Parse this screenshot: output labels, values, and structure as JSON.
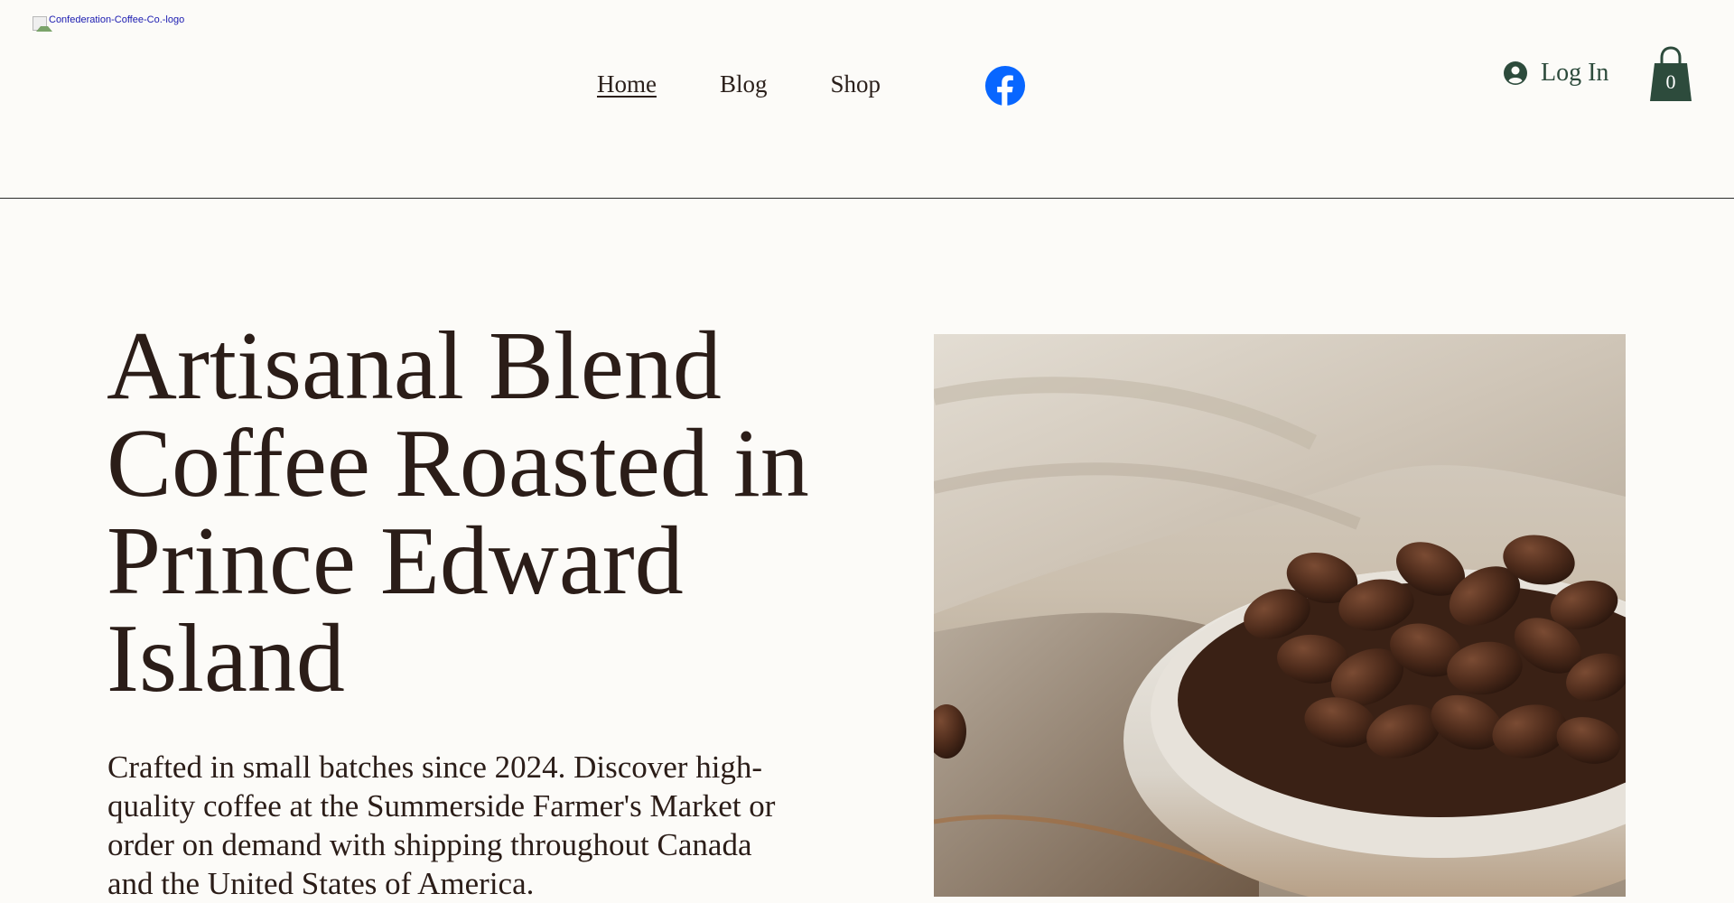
{
  "header": {
    "logo_alt": "Confederation-Coffee-Co.-logo",
    "nav": [
      {
        "label": "Home"
      },
      {
        "label": "Blog"
      },
      {
        "label": "Shop"
      }
    ],
    "facebook_icon": "facebook-icon",
    "login_label": "Log In",
    "cart_count": "0"
  },
  "hero": {
    "title": "Artisanal Blend Coffee Roasted in Prince Edward Island",
    "description": "Crafted in small batches since 2024. Discover high-quality coffee at the Summerside Farmer's Market or order on demand with shipping throughout Canada and the United States of America."
  },
  "colors": {
    "background": "#fcfbf8",
    "text": "#2b1d18",
    "accent_green": "#2d4b3c",
    "facebook_blue": "#0866ff",
    "link_blue": "#1a1ab0"
  }
}
